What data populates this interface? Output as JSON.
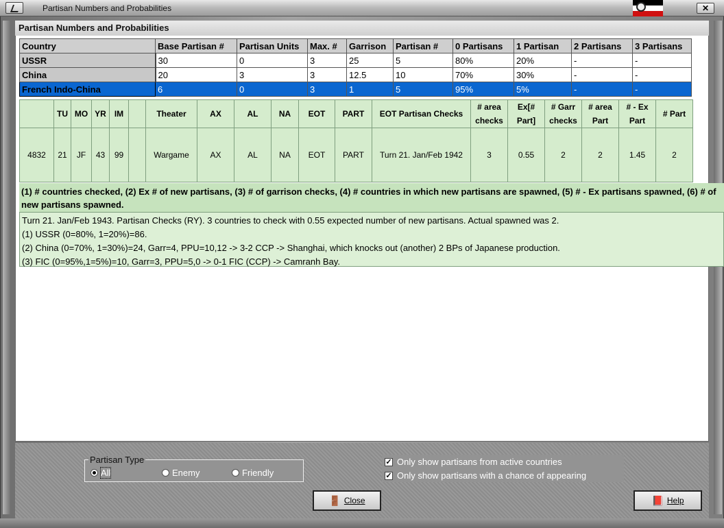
{
  "window": {
    "title": "Partisan Numbers and Probabilities",
    "close_glyph": "✕"
  },
  "panel": {
    "title": "Partisan Numbers and Probabilities"
  },
  "country_table": {
    "headers": [
      "Country",
      "Base Partisan #",
      "Partisan Units",
      "Max. #",
      "Garrison",
      "Partisan #",
      "0 Partisans",
      "1 Partisan",
      "2 Partisans",
      "3 Partisans"
    ],
    "rows": [
      [
        "USSR",
        "30",
        "0",
        "3",
        "25",
        "5",
        "80%",
        "20%",
        "-",
        "-"
      ],
      [
        "China",
        "20",
        "3",
        "3",
        "12.5",
        "10",
        "70%",
        "30%",
        "-",
        "-"
      ],
      [
        "French Indo-China",
        "6",
        "0",
        "3",
        "1",
        "5",
        "95%",
        "5%",
        "-",
        "-"
      ]
    ],
    "selected_row": 2
  },
  "check_table": {
    "headers": [
      "",
      "TU",
      "MO",
      "YR",
      "IM",
      "",
      "Theater",
      "AX",
      "AL",
      "NA",
      "EOT",
      "PART",
      "EOT Partisan Checks",
      "# area checks",
      "Ex[# Part]",
      "# Garr checks",
      "# area Part",
      "# - Ex Part",
      "# Part"
    ],
    "row": [
      "4832",
      "21",
      "JF",
      "43",
      "99",
      "",
      "Wargame",
      "AX",
      "AL",
      "NA",
      "EOT",
      "PART",
      "Turn 21. Jan/Feb 1942",
      "3",
      "0.55",
      "2",
      "2",
      "1.45",
      "2"
    ]
  },
  "legend_text": "(1) # countries checked, (2)  Ex # of new partisans, (3) # of garrison checks, (4) # countries in which new partisans are spawned, (5) # - Ex partisans spawned, (6) # of new partisans spawned.",
  "notes": [
    "Turn 21.  Jan/Feb 1943.  Partisan Checks (RY).  3 countries to check with 0.55 expected number of new partisans.  Actual spawned was 2.",
    "(1) USSR (0=80%, 1=20%)=86.",
    "(2) China (0=70%, 1=30%)=24, Garr=4, PPU=10,12 -> 3-2 CCP -> Shanghai, which knocks out (another) 2 BPs of Japanese production.",
    "(3) FIC (0=95%,1=5%)=10, Garr=3, PPU=5,0 -> 0-1 FIC (CCP) -> Camranh Bay."
  ],
  "partisan_type": {
    "label": "Partisan Type",
    "options": [
      "All",
      "Enemy",
      "Friendly"
    ],
    "selected": "All"
  },
  "filters": {
    "active_countries": {
      "label": "Only show partisans from active countries",
      "checked": true
    },
    "chance_appearing": {
      "label": "Only show partisans with a chance of appearing",
      "checked": true
    }
  },
  "buttons": {
    "close": "Close",
    "help": "Help"
  },
  "colors": {
    "selection": "#0a66d0",
    "green_bg": "#d5eccd",
    "legend_bg": "#c6e3bd"
  }
}
